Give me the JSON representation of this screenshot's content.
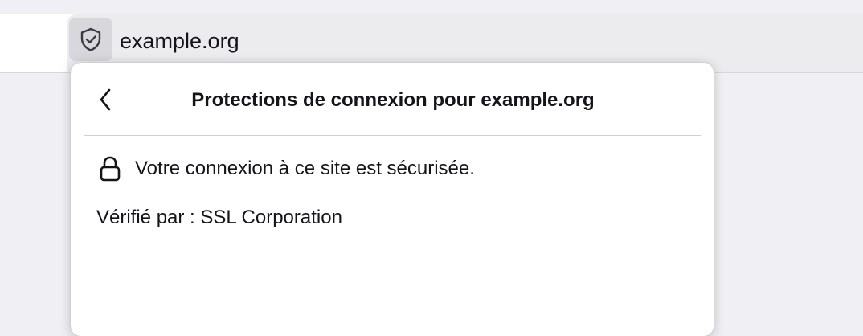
{
  "urlbar": {
    "url": "example.org",
    "identity_icon": "shield-check-icon"
  },
  "panel": {
    "title": "Protections de connexion pour example.org",
    "back_icon": "chevron-left-icon",
    "connection_icon": "lock-icon",
    "connection_status": "Votre connexion à ce site est sécurisée.",
    "verified_by": "Vérifié par : SSL Corporation"
  },
  "colors": {
    "text": "#15141a",
    "toolbar_bg": "#f0f0f4",
    "urlbar_bg": "#ececef",
    "icon_button_bg": "#d7d7dc",
    "panel_bg": "#ffffff",
    "divider": "#cfcfd8"
  }
}
